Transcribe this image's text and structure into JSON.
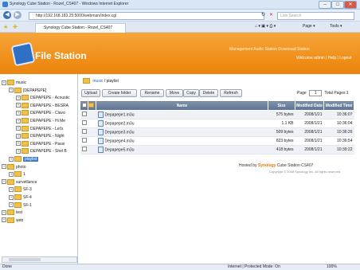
{
  "window": {
    "title": "Synology Cube Station - Rozel_CS407 - Windows Internet Explorer",
    "min_btn": "–",
    "max_btn": "□",
    "close_btn": "✕"
  },
  "browser": {
    "url": "http://192.168.183.25:5000/webman/index.cgi",
    "search_placeholder": "Live Search",
    "tab_title": "Synology Cube Station - Rozel_CS407",
    "commands": {
      "page": "Page ▾",
      "tools": "Tools ▾"
    }
  },
  "header": {
    "app_title": "File Station",
    "top_links": "Management   Audio Station   Download Station",
    "welcome": "Welcome admin | Help | Logout"
  },
  "sidebar": {
    "items": [
      {
        "label": "music",
        "level": 0
      },
      {
        "label": "[DEPAPEPE]",
        "level": 1
      },
      {
        "label": "DEPAPEPE - Acoustic",
        "level": 2
      },
      {
        "label": "DEPAPEPE - BESRA",
        "level": 2
      },
      {
        "label": "DEPAPEPE - Clavo",
        "level": 2
      },
      {
        "label": "DEPAPEPE - Hi Me",
        "level": 2
      },
      {
        "label": "DEPAPEPE - Let's",
        "level": 2
      },
      {
        "label": "DEPAPEPE - Night",
        "level": 2
      },
      {
        "label": "DEPAPEPE - Passi",
        "level": 2
      },
      {
        "label": "DEPAPEPE - Shel B",
        "level": 2
      },
      {
        "label": "playlist",
        "level": 1,
        "selected": true
      },
      {
        "label": "photo",
        "level": 0
      },
      {
        "label": "1",
        "level": 1
      },
      {
        "label": "surveillance",
        "level": 0
      },
      {
        "label": "SF-3",
        "level": 1
      },
      {
        "label": "SF-4",
        "level": 1
      },
      {
        "label": "SF-1",
        "level": 1
      },
      {
        "label": "test",
        "level": 0
      },
      {
        "label": "web",
        "level": 0
      }
    ]
  },
  "main": {
    "breadcrumb": {
      "root": "music",
      "current": "/ playlist"
    },
    "toolbar": {
      "upload": "Upload",
      "create_folder": "Create folder",
      "rename": "Rename",
      "move": "Move",
      "copy": "Copy",
      "delete": "Delete",
      "refresh": "Refresh"
    },
    "pager": {
      "label": "Page",
      "value": "1",
      "total": "Total Pages:1"
    },
    "columns": {
      "name": "Name",
      "size": "Size",
      "modified_date": "Modified Date",
      "modified_time": "Modified Time"
    },
    "files": [
      {
        "name": "Depapepe1.m3u",
        "size": "575 bytes",
        "date": "2008/1/21",
        "time": "10:36:07"
      },
      {
        "name": "Depapepe2.m3u",
        "size": "1.1 KB",
        "date": "2008/1/21",
        "time": "10:36:04"
      },
      {
        "name": "Depapepe3.m3u",
        "size": "509 bytes",
        "date": "2008/1/21",
        "time": "10:36:26"
      },
      {
        "name": "Depapepe4.m3u",
        "size": "823 bytes",
        "date": "2008/1/21",
        "time": "10:36:54"
      },
      {
        "name": "Depapepe5.m3u",
        "size": "418 bytes",
        "date": "2008/1/21",
        "time": "10:39:22"
      }
    ],
    "footer": {
      "hosted_by": "Hosted by",
      "brand": "Synology",
      "model": "Cube Station CS407",
      "copyright": "Copyright © 2008 Synology Inc. All rights reserved."
    }
  },
  "status": {
    "left": "Done",
    "zone": "Internet | Protected Mode: On",
    "zoom": "100%"
  },
  "colors": {
    "header_orange": "#ef8d16",
    "table_header": "#6b809c",
    "selection": "#3e7bd0"
  }
}
